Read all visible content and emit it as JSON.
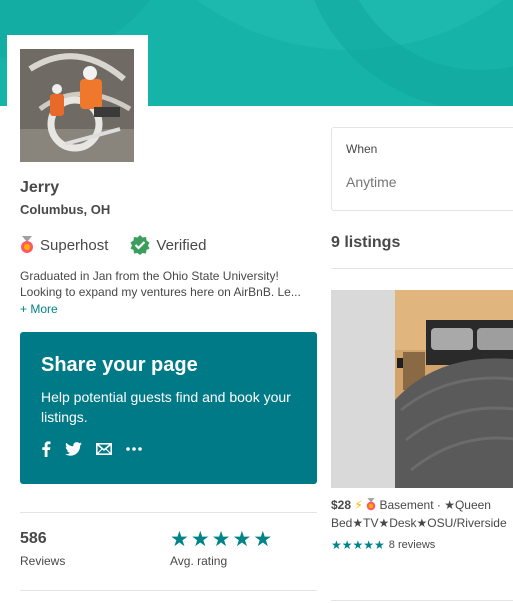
{
  "host": {
    "name": "Jerry",
    "location": "Columbus, OH",
    "badges": {
      "superhost": "Superhost",
      "verified": "Verified"
    },
    "bio": "Graduated in Jan from the Ohio State University! Looking to expand my ventures here on AirBnB. Le...",
    "more_link": "+ More"
  },
  "share": {
    "title": "Share your page",
    "text": "Help potential guests find and book your listings.",
    "icons": [
      "facebook-icon",
      "twitter-icon",
      "email-icon",
      "more-icon"
    ]
  },
  "stats": {
    "reviews_count": "586",
    "reviews_label": "Reviews",
    "rating_label": "Avg. rating",
    "rating_stars": 5
  },
  "search": {
    "when_label": "When",
    "when_value": "Anytime"
  },
  "listings": {
    "count_label": "9 listings",
    "items": [
      {
        "price": "$28",
        "title_line1": "Basement · ★Queen",
        "title_line2": "Bed★TV★Desk★OSU/Riverside",
        "reviews": "8 reviews",
        "stars": 5
      }
    ]
  },
  "colors": {
    "banner": "#16b3a8",
    "share_bg": "#007a87",
    "accent": "#008489",
    "verified": "#3c9e5b",
    "superhost": "#ff5a5f"
  }
}
